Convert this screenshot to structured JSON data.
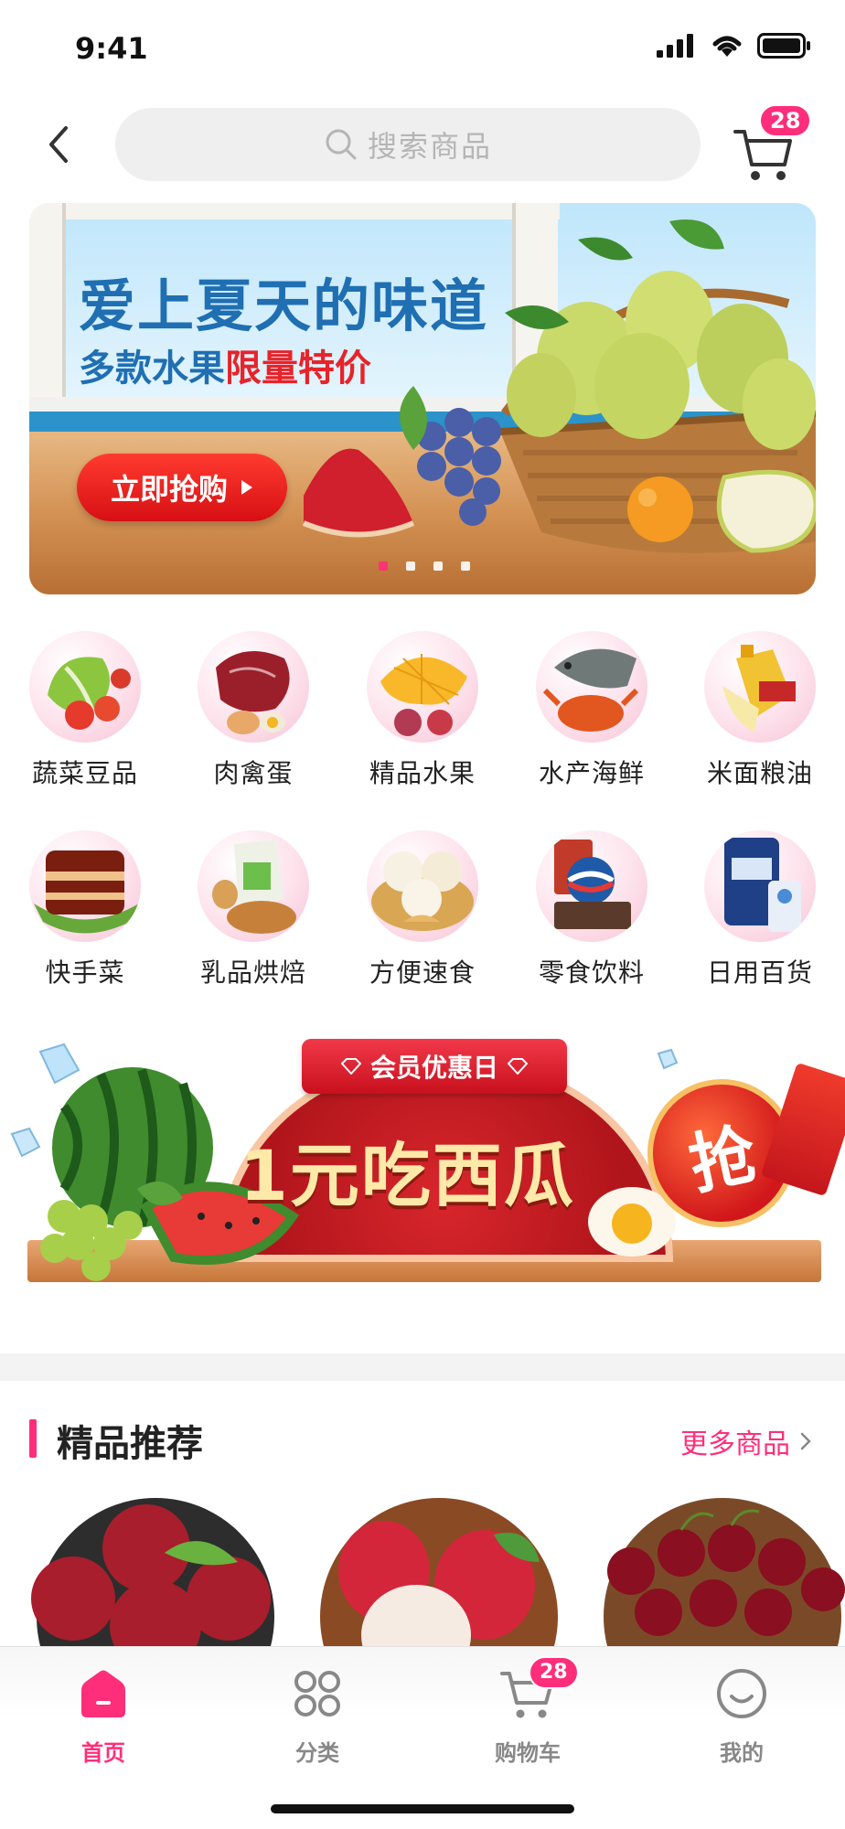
{
  "status": {
    "time": "9:41"
  },
  "header": {
    "search_placeholder": "搜索商品",
    "cart_badge": "28"
  },
  "banner": {
    "title": "爱上夏天的味道",
    "sub_prefix": "多款水果",
    "sub_highlight": "限量特价",
    "button": "立即抢购",
    "active_dot": 0,
    "dot_count": 4
  },
  "categories": [
    {
      "label": "蔬菜豆品",
      "icon": "vegetables-icon"
    },
    {
      "label": "肉禽蛋",
      "icon": "meat-icon"
    },
    {
      "label": "精品水果",
      "icon": "fruit-icon"
    },
    {
      "label": "水产海鲜",
      "icon": "seafood-icon"
    },
    {
      "label": "米面粮油",
      "icon": "grain-oil-icon"
    },
    {
      "label": "快手菜",
      "icon": "quick-dish-icon"
    },
    {
      "label": "乳品烘焙",
      "icon": "dairy-bakery-icon"
    },
    {
      "label": "方便速食",
      "icon": "instant-food-icon"
    },
    {
      "label": "零食饮料",
      "icon": "snacks-drinks-icon"
    },
    {
      "label": "日用百货",
      "icon": "daily-goods-icon"
    }
  ],
  "promo": {
    "tag": "会员优惠日",
    "headline": "1元吃西瓜",
    "grab": "抢"
  },
  "section": {
    "title": "精品推荐",
    "more": "更多商品"
  },
  "tabbar": {
    "items": [
      {
        "label": "首页",
        "icon": "home-icon",
        "active": true
      },
      {
        "label": "分类",
        "icon": "category-icon",
        "active": false
      },
      {
        "label": "购物车",
        "icon": "cart-icon",
        "active": false
      },
      {
        "label": "我的",
        "icon": "profile-icon",
        "active": false
      }
    ],
    "cart_badge": "28"
  },
  "colors": {
    "accent": "#ff2e7a",
    "banner_title": "#1f6fb2",
    "promo_red": "#c8101d"
  }
}
